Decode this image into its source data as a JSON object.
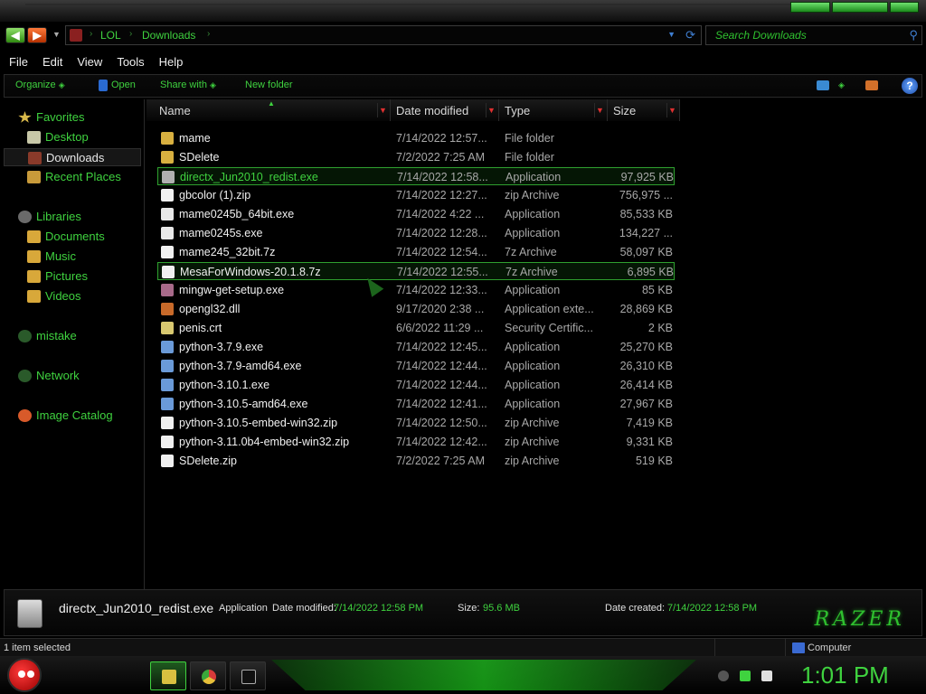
{
  "window": {
    "breadcrumb": [
      "LOL",
      "Downloads"
    ],
    "search_placeholder": "Search Downloads"
  },
  "menu": [
    "File",
    "Edit",
    "View",
    "Tools",
    "Help"
  ],
  "commands": {
    "organize": "Organize",
    "open": "Open",
    "share_with": "Share with",
    "new_folder": "New folder"
  },
  "nav": {
    "favorites": "Favorites",
    "desktop": "Desktop",
    "downloads": "Downloads",
    "recent_places": "Recent Places",
    "libraries": "Libraries",
    "documents": "Documents",
    "music": "Music",
    "pictures": "Pictures",
    "videos": "Videos",
    "mistake": "mistake",
    "network": "Network",
    "image_catalog": "Image Catalog"
  },
  "columns": {
    "name": "Name",
    "date": "Date modified",
    "type": "Type",
    "size": "Size"
  },
  "files": [
    {
      "name": "mame",
      "date": "7/14/2022 12:57...",
      "type": "File folder",
      "size": ""
    },
    {
      "name": "SDelete",
      "date": "7/2/2022 7:25 AM",
      "type": "File folder",
      "size": ""
    },
    {
      "name": "directx_Jun2010_redist.exe",
      "date": "7/14/2022 12:58...",
      "type": "Application",
      "size": "97,925 KB"
    },
    {
      "name": "gbcolor (1).zip",
      "date": "7/14/2022 12:27...",
      "type": "zip Archive",
      "size": "756,975 ..."
    },
    {
      "name": "mame0245b_64bit.exe",
      "date": "7/14/2022 4:22 ...",
      "type": "Application",
      "size": "85,533 KB"
    },
    {
      "name": "mame0245s.exe",
      "date": "7/14/2022 12:28...",
      "type": "Application",
      "size": "134,227 ..."
    },
    {
      "name": "mame245_32bit.7z",
      "date": "7/14/2022 12:54...",
      "type": "7z Archive",
      "size": "58,097 KB"
    },
    {
      "name": "MesaForWindows-20.1.8.7z",
      "date": "7/14/2022 12:55...",
      "type": "7z Archive",
      "size": "6,895 KB"
    },
    {
      "name": "mingw-get-setup.exe",
      "date": "7/14/2022 12:33...",
      "type": "Application",
      "size": "85 KB"
    },
    {
      "name": "opengl32.dll",
      "date": "9/17/2020 2:38 ...",
      "type": "Application exte...",
      "size": "28,869 KB"
    },
    {
      "name": "penis.crt",
      "date": "6/6/2022 11:29 ...",
      "type": "Security Certific...",
      "size": "2 KB"
    },
    {
      "name": "python-3.7.9.exe",
      "date": "7/14/2022 12:45...",
      "type": "Application",
      "size": "25,270 KB"
    },
    {
      "name": "python-3.7.9-amd64.exe",
      "date": "7/14/2022 12:44...",
      "type": "Application",
      "size": "26,310 KB"
    },
    {
      "name": "python-3.10.1.exe",
      "date": "7/14/2022 12:44...",
      "type": "Application",
      "size": "26,414 KB"
    },
    {
      "name": "python-3.10.5-amd64.exe",
      "date": "7/14/2022 12:41...",
      "type": "Application",
      "size": "27,967 KB"
    },
    {
      "name": "python-3.10.5-embed-win32.zip",
      "date": "7/14/2022 12:50...",
      "type": "zip Archive",
      "size": "7,419 KB"
    },
    {
      "name": "python-3.11.0b4-embed-win32.zip",
      "date": "7/14/2022 12:42...",
      "type": "zip Archive",
      "size": "9,331 KB"
    },
    {
      "name": "SDelete.zip",
      "date": "7/2/2022 7:25 AM",
      "type": "zip Archive",
      "size": "519 KB"
    }
  ],
  "details": {
    "name": "directx_Jun2010_redist.exe",
    "type": "Application",
    "date_modified_label": "Date modified:",
    "date_modified": "7/14/2022 12:58 PM",
    "size_label": "Size:",
    "size": "95.6 MB",
    "date_created_label": "Date created:",
    "date_created": "7/14/2022 12:58 PM",
    "logo": "RAZER"
  },
  "status": {
    "selection": "1 item selected",
    "location": "Computer"
  },
  "taskbar": {
    "clock": "1:01 PM"
  },
  "colors": {
    "accent": "#3fd23f",
    "background": "#000000",
    "selection_border": "#2fa02f"
  }
}
